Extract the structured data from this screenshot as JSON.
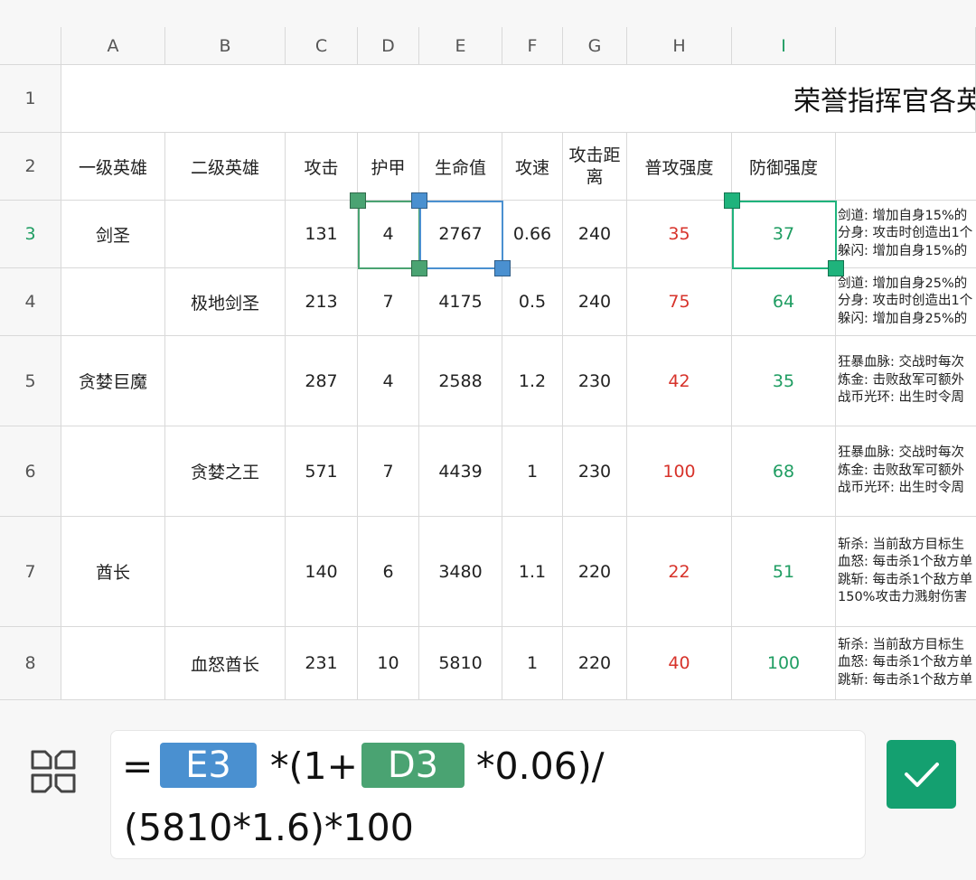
{
  "columns": [
    "A",
    "B",
    "C",
    "D",
    "E",
    "F",
    "G",
    "H",
    "I"
  ],
  "title": "荣誉指挥官各英雄属性",
  "row_numbers": [
    "1",
    "2",
    "3",
    "4",
    "5",
    "6",
    "7",
    "8"
  ],
  "headers": {
    "a": "一级英雄",
    "b": "二级英雄",
    "c": "攻击",
    "d": "护甲",
    "e": "生命值",
    "f": "攻速",
    "g_line1": "攻击距",
    "g_line2": "离",
    "h": "普攻强度",
    "i": "防御强度"
  },
  "rows": [
    {
      "a": "剑圣",
      "b": "",
      "c": "131",
      "d": "4",
      "e": "2767",
      "f": "0.66",
      "g": "240",
      "h": "35",
      "i": "37",
      "skills": [
        "剑道: 增加自身15%的",
        "分身: 攻击时创造出1个",
        "躲闪: 增加自身15%的"
      ]
    },
    {
      "a": "",
      "b": "极地剑圣",
      "c": "213",
      "d": "7",
      "e": "4175",
      "f": "0.5",
      "g": "240",
      "h": "75",
      "i": "64",
      "skills": [
        "剑道: 增加自身25%的",
        "分身: 攻击时创造出1个",
        "躲闪: 增加自身25%的"
      ]
    },
    {
      "a": "贪婪巨魔",
      "b": "",
      "c": "287",
      "d": "4",
      "e": "2588",
      "f": "1.2",
      "g": "230",
      "h": "42",
      "i": "35",
      "skills": [
        "狂暴血脉: 交战时每次",
        "炼金: 击败敌军可额外",
        "战币光环: 出生时令周"
      ]
    },
    {
      "a": "",
      "b": "贪婪之王",
      "c": "571",
      "d": "7",
      "e": "4439",
      "f": "1",
      "g": "230",
      "h": "100",
      "i": "68",
      "skills": [
        "狂暴血脉: 交战时每次",
        "炼金: 击败敌军可额外",
        "战币光环: 出生时令周"
      ]
    },
    {
      "a": "酋长",
      "b": "",
      "c": "140",
      "d": "6",
      "e": "3480",
      "f": "1.1",
      "g": "220",
      "h": "22",
      "i": "51",
      "skills": [
        "斩杀: 当前敌方目标生",
        "血怒: 每击杀1个敌方单",
        "跳斩: 每击杀1个敌方单",
        "150%攻击力溅射伤害"
      ]
    },
    {
      "a": "",
      "b": "血怒酋长",
      "c": "231",
      "d": "10",
      "e": "5810",
      "f": "1",
      "g": "220",
      "h": "40",
      "i": "100",
      "skills": [
        "斩杀: 当前敌方目标生",
        "血怒: 每击杀1个敌方单",
        "跳斩: 每击杀1个敌方单"
      ]
    }
  ],
  "formula": {
    "equals": "=",
    "ref1": "E3",
    "part2": "*(1+",
    "ref2": "D3",
    "part3": "*0.06)/",
    "line2": "(5810*1.6)*100"
  },
  "colors": {
    "ref_e3": "#4a90d0",
    "ref_d3": "#4aa372",
    "selection": "#1fb37c",
    "confirm": "#14a070",
    "red_value": "#d7332b",
    "green_value": "#1f9d62"
  },
  "icons": {
    "formula_panel": "function-panel-icon",
    "confirm": "check-icon"
  }
}
